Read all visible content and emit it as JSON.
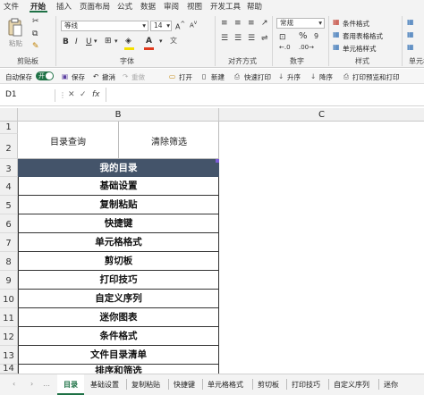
{
  "menu": [
    "文件",
    "开始",
    "插入",
    "页面布局",
    "公式",
    "数据",
    "审阅",
    "视图",
    "开发工具",
    "帮助"
  ],
  "ribbon": {
    "paste_label": "粘贴",
    "clipboard_label": "剪贴板",
    "font_name": "等线",
    "font_size": "14",
    "font_label": "字体",
    "align_label": "对齐方式",
    "number_format": "常规",
    "number_label": "数字",
    "cond_format": "条件格式",
    "table_format": "套用表格格式",
    "cell_style": "单元格样式",
    "style_label": "样式",
    "cells_label": "单元格",
    "font_color": "#e03a1e",
    "fill_color": "#f5e000"
  },
  "qat": {
    "autosave_label": "自动保存",
    "toggle_label": "开",
    "save": "保存",
    "undo": "撤消",
    "redo": "重做",
    "open": "打开",
    "new": "新建",
    "quick_print": "快速打印",
    "sort_asc": "升序",
    "sort_desc": "降序",
    "print_preview": "打印预览和打印"
  },
  "formula_bar": {
    "name_box": "D1",
    "fx": "fx",
    "content": ""
  },
  "columns": [
    "B",
    "C"
  ],
  "cells": {
    "b1": "目录查询",
    "b1_right": "清除筛选",
    "header": "我的目录",
    "header_bg": "#44546a"
  },
  "row_numbers": [
    "1",
    "2",
    "3",
    "4",
    "5",
    "6",
    "7",
    "8",
    "9",
    "10",
    "11",
    "12",
    "13",
    "14"
  ],
  "directory": [
    "基础设置",
    "复制粘贴",
    "快捷键",
    "单元格格式",
    "剪切板",
    "打印技巧",
    "自定义序列",
    "迷你图表",
    "条件格式",
    "文件目录清单",
    "排序和筛选"
  ],
  "sheet_tabs": {
    "active": "目录",
    "others": [
      "基础设置",
      "复制粘贴",
      "快捷键",
      "单元格格式",
      "剪切板",
      "打印技巧",
      "自定义序列",
      "迷你"
    ]
  },
  "accent": "#1e7145"
}
